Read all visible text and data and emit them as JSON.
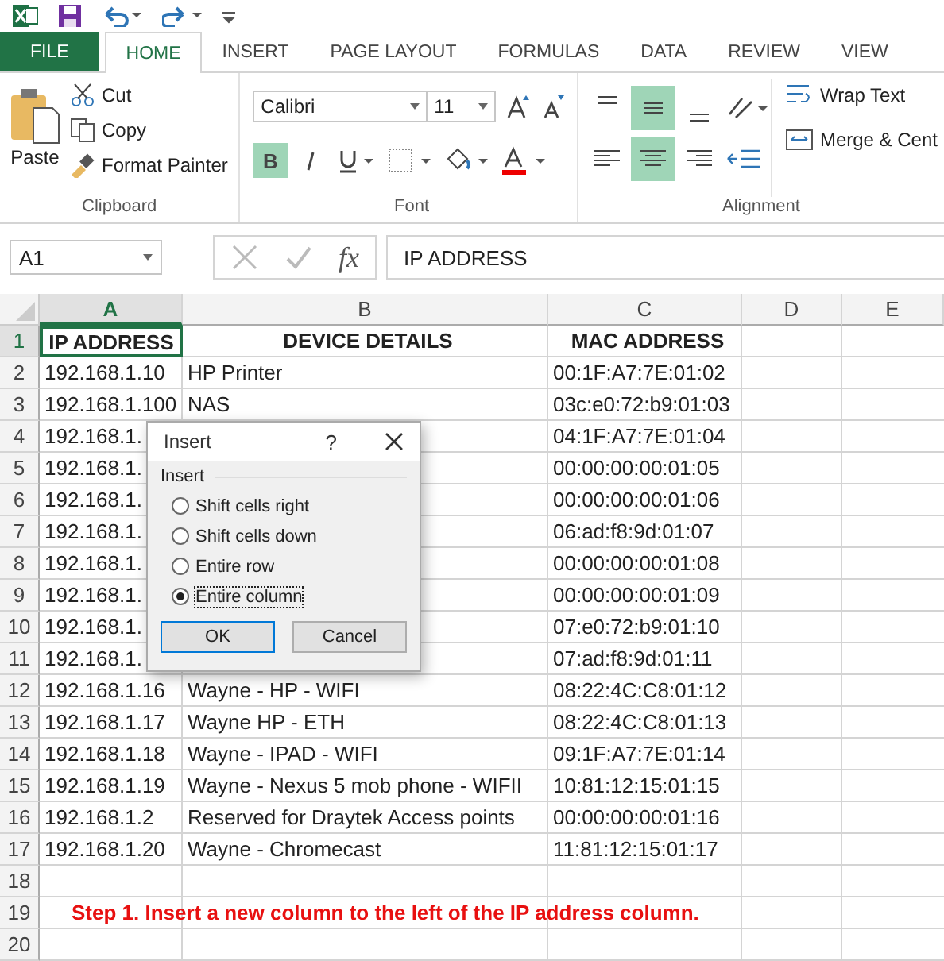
{
  "tabs": [
    {
      "label": "FILE",
      "selected": false,
      "kind": "file"
    },
    {
      "label": "HOME",
      "selected": true,
      "kind": "tab"
    },
    {
      "label": "INSERT",
      "selected": false,
      "kind": "tab"
    },
    {
      "label": "PAGE LAYOUT",
      "selected": false,
      "kind": "tab"
    },
    {
      "label": "FORMULAS",
      "selected": false,
      "kind": "tab"
    },
    {
      "label": "DATA",
      "selected": false,
      "kind": "tab"
    },
    {
      "label": "REVIEW",
      "selected": false,
      "kind": "tab"
    },
    {
      "label": "VIEW",
      "selected": false,
      "kind": "tab"
    }
  ],
  "clipboard": {
    "paste": "Paste",
    "cut": "Cut",
    "copy": "Copy",
    "format_painter": "Format Painter",
    "label": "Clipboard"
  },
  "font": {
    "name": "Calibri",
    "size": "11",
    "bold": true,
    "bold_label": "B",
    "label": "Font"
  },
  "alignment": {
    "vertical": [
      {
        "kind": "top",
        "selected": false
      },
      {
        "kind": "middle",
        "selected": true
      },
      {
        "kind": "bottom",
        "selected": false
      }
    ],
    "horizontal": [
      {
        "kind": "left",
        "selected": false
      },
      {
        "kind": "center",
        "selected": true
      },
      {
        "kind": "right",
        "selected": false
      }
    ],
    "wrap_text": "Wrap Text",
    "merge": "Merge & Cent",
    "label": "Alignment"
  },
  "name_box": "A1",
  "fx": "fx",
  "formula": "IP ADDRESS",
  "columns": [
    {
      "label": "A",
      "selected": true
    },
    {
      "label": "B",
      "selected": false
    },
    {
      "label": "C",
      "selected": false
    },
    {
      "label": "D",
      "selected": false
    },
    {
      "label": "E",
      "selected": false
    }
  ],
  "rows": [
    {
      "number": "1",
      "kind": "header",
      "selected": true,
      "a": "IP ADDRESS",
      "b": "DEVICE DETAILS",
      "c": "MAC ADDRESS"
    },
    {
      "number": "2",
      "kind": "data",
      "selected": false,
      "a": "192.168.1.10",
      "b": "HP  Printer",
      "c": "00:1F:A7:7E:01:02"
    },
    {
      "number": "3",
      "kind": "data",
      "selected": false,
      "a": "192.168.1.100",
      "b": "NAS",
      "c": "03c:e0:72:b9:01:03"
    },
    {
      "number": "4",
      "kind": "data",
      "selected": false,
      "a": "192.168.1.",
      "c": "04:1F:A7:7E:01:04"
    },
    {
      "number": "5",
      "kind": "data",
      "selected": false,
      "a": "192.168.1.",
      "c": "00:00:00:00:01:05"
    },
    {
      "number": "6",
      "kind": "data",
      "selected": false,
      "a": "192.168.1.",
      "c": "00:00:00:00:01:06"
    },
    {
      "number": "7",
      "kind": "data",
      "selected": false,
      "a": "192.168.1.",
      "c": "06:ad:f8:9d:01:07"
    },
    {
      "number": "8",
      "kind": "data",
      "selected": false,
      "a": "192.168.1.",
      "c": "00:00:00:00:01:08"
    },
    {
      "number": "9",
      "kind": "data",
      "selected": false,
      "a": "192.168.1.",
      "c": "00:00:00:00:01:09"
    },
    {
      "number": "10",
      "kind": "data",
      "selected": false,
      "a": "192.168.1.",
      "c": "07:e0:72:b9:01:10"
    },
    {
      "number": "11",
      "kind": "data",
      "selected": false,
      "a": "192.168.1.",
      "c": "07:ad:f8:9d:01:11"
    },
    {
      "number": "12",
      "kind": "data",
      "selected": false,
      "a": "192.168.1.16",
      "b": "Wayne - HP - WIFI",
      "c": "08:22:4C:C8:01:12"
    },
    {
      "number": "13",
      "kind": "data",
      "selected": false,
      "a": "192.168.1.17",
      "b": "Wayne  HP - ETH",
      "c": "08:22:4C:C8:01:13"
    },
    {
      "number": "14",
      "kind": "data",
      "selected": false,
      "a": "192.168.1.18",
      "b": "Wayne - IPAD - WIFI",
      "c": "09:1F:A7:7E:01:14"
    },
    {
      "number": "15",
      "kind": "data",
      "selected": false,
      "a": "192.168.1.19",
      "b": "Wayne - Nexus 5 mob phone - WIFII",
      "c": "10:81:12:15:01:15"
    },
    {
      "number": "16",
      "kind": "data",
      "selected": false,
      "a": "192.168.1.2",
      "b": "Reserved for Draytek Access points",
      "c": "00:00:00:00:01:16"
    },
    {
      "number": "17",
      "kind": "data",
      "selected": false,
      "a": "192.168.1.20",
      "b": "Wayne - Chromecast",
      "c": "11:81:12:15:01:17"
    },
    {
      "number": "18",
      "kind": "data",
      "selected": false
    },
    {
      "number": "19",
      "kind": "note",
      "selected": false,
      "note": "Step 1. Insert a new column to the left of the IP address column."
    },
    {
      "number": "20",
      "kind": "data",
      "selected": false
    }
  ],
  "dialog": {
    "title": "Insert",
    "help": "?",
    "group": "Insert",
    "options": [
      {
        "label": "Shift cells right",
        "selected": false
      },
      {
        "label": "Shift cells down",
        "selected": false
      },
      {
        "label": "Entire row",
        "selected": false
      },
      {
        "label": "Entire column",
        "selected": true
      }
    ],
    "ok": "OK",
    "cancel": "Cancel"
  }
}
